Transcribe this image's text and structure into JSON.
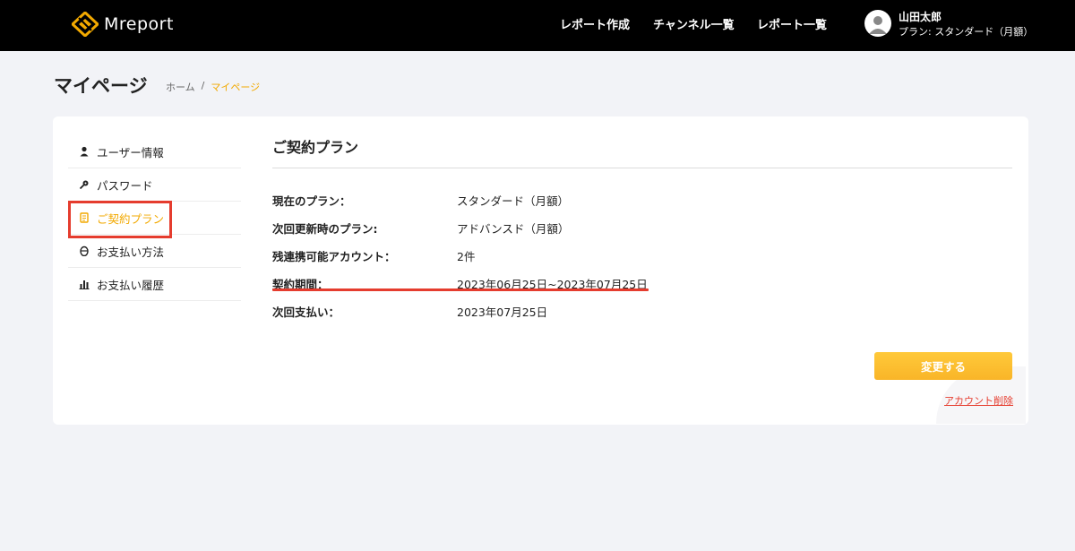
{
  "header": {
    "logo_text": "Mreport",
    "brand_color": "#f2a900",
    "nav": [
      {
        "label": "レポート作成"
      },
      {
        "label": "チャンネル一覧"
      },
      {
        "label": "レポート一覧"
      }
    ],
    "user": {
      "name": "山田太郎",
      "plan": "プラン: スタンダード（月額）"
    }
  },
  "page": {
    "title": "マイページ",
    "breadcrumb": {
      "home": "ホーム",
      "separator": "/",
      "current": "マイページ"
    }
  },
  "sidebar": {
    "items": [
      {
        "label": "ユーザー情報",
        "icon": "user-icon"
      },
      {
        "label": "パスワード",
        "icon": "key-icon"
      },
      {
        "label": "ご契約プラン",
        "icon": "contract-icon",
        "active": true
      },
      {
        "label": "お支払い方法",
        "icon": "payment-icon"
      },
      {
        "label": "お支払い履歴",
        "icon": "history-chart-icon"
      }
    ]
  },
  "contract": {
    "title": "ご契約プラン",
    "rows": [
      {
        "label": "現在のプラン：",
        "value": "スタンダード（月額）"
      },
      {
        "label": "次回更新時のプラン:",
        "value": "アドバンスド（月額）"
      },
      {
        "label": "残連携可能アカウント：",
        "value": "2件"
      },
      {
        "label": "契約期間：",
        "value": "2023年06月25日~2023年07月25日"
      },
      {
        "label": "次回支払い：",
        "value": "2023年07月25日"
      }
    ],
    "change_button": "変更する",
    "delete_link": "アカウント削除"
  },
  "colors": {
    "accent": "#f2a900",
    "highlight": "#e53c2e"
  }
}
